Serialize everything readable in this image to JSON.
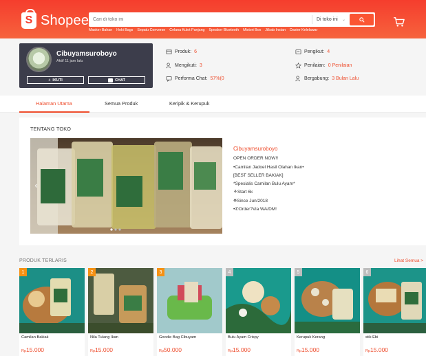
{
  "brand": {
    "name": "Shopee"
  },
  "search": {
    "placeholder": "Cari di toko ini",
    "scope": "Di toko ini",
    "keywords": [
      "Masker Bahan",
      "Hoki Bags",
      "Sepatu Converse",
      "Celana Kulot Panjang",
      "Speaker Bluetooth",
      "Mistori Box",
      "Jilbab Instan",
      "Daster Kelelawar"
    ]
  },
  "shop": {
    "name": "Cibuyamsuroboyo",
    "active": "Aktif 11 jam lalu",
    "follow_label": "IKUTI",
    "chat_label": "CHAT"
  },
  "stats": {
    "produk_label": "Produk:",
    "produk_value": "6",
    "mengikuti_label": "Mengikuti:",
    "mengikuti_value": "3",
    "chat_label": "Performa Chat:",
    "chat_value": "57%(0",
    "pengikut_label": "Pengikut:",
    "pengikut_value": "4",
    "penilaian_label": "Penilaian:",
    "penilaian_value": "0 Penilaian",
    "bergabung_label": "Bergabung:",
    "bergabung_value": "3 Bulan Lalu"
  },
  "tabs": [
    "Halaman Utama",
    "Semua Produk",
    "Keripik & Kerupuk"
  ],
  "about": {
    "title": "TENTANG TOKO",
    "shop_name": "Cibuyamsuroboyo",
    "lines": [
      "OPEN ORDER NOW!!",
      "•Camilan Jadoel Hasil Olahan Ikan•",
      "[BEST SELLER BAKIAK]",
      "*Spesialis Camilan Bulu Ayam*",
      "⚘Start 6k",
      "⛯Since Jun/2018",
      "•✆Order?Via WA/DM!"
    ]
  },
  "products_section": {
    "title": "PRODUK TERLARIS",
    "see_all": "Lihat Semua >"
  },
  "products": [
    {
      "rank": "1",
      "title": "Camilan Bakiak",
      "currency": "Rp",
      "price": "15.000",
      "rank_color": "#f69113"
    },
    {
      "rank": "2",
      "title": "Nila Tulang Ikan",
      "currency": "Rp",
      "price": "15.000",
      "rank_color": "#f69113"
    },
    {
      "rank": "3",
      "title": "Goodie Bag Cibuyam",
      "currency": "Rp",
      "price": "50.000",
      "rank_color": "#f69113"
    },
    {
      "rank": "4",
      "title": "Bulu Ayam Crispy",
      "currency": "Rp",
      "price": "15.000",
      "rank_color": "#bdbdbd"
    },
    {
      "rank": "5",
      "title": "Kerupuk Kerang",
      "currency": "Rp",
      "price": "15.000",
      "rank_color": "#bdbdbd"
    },
    {
      "rank": "6",
      "title": "stik Ebi",
      "currency": "Rp",
      "price": "15.000",
      "rank_color": "#bdbdbd"
    }
  ],
  "colors": {
    "brand": "#ee4d2d",
    "header": "#f53d2d",
    "shopcard": "#3c3d4b"
  }
}
